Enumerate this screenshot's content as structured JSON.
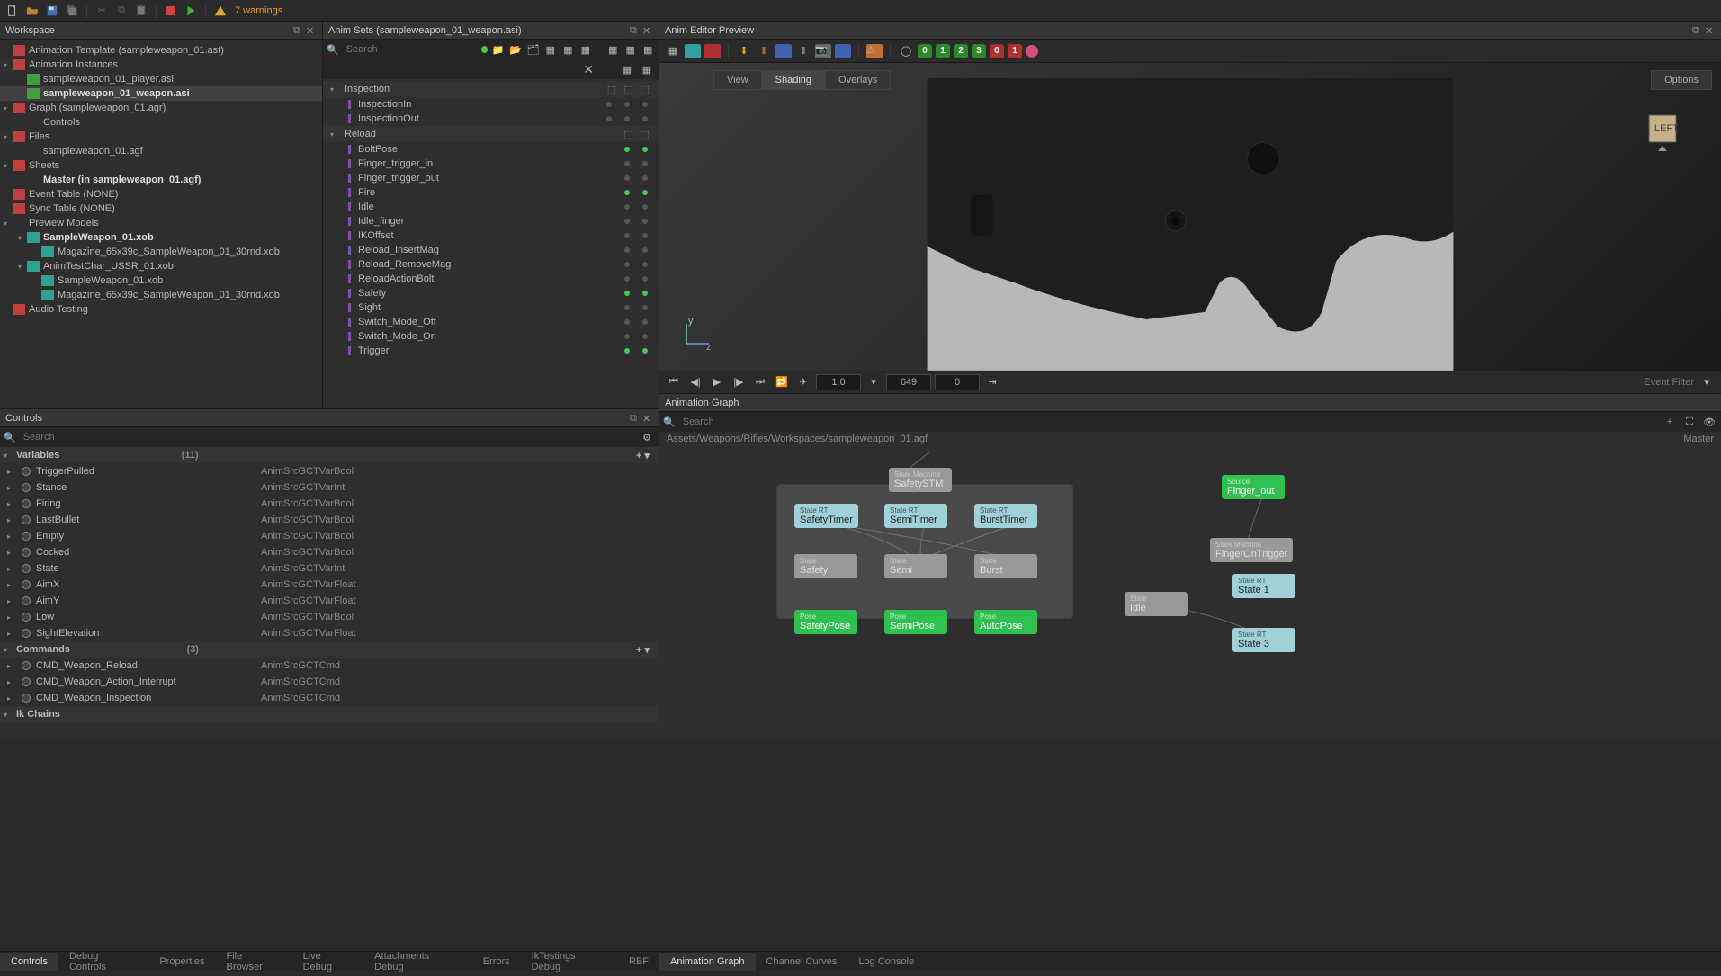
{
  "toolbar": {
    "warnings_text": "7 warnings"
  },
  "workspace": {
    "title": "Workspace",
    "tree": [
      {
        "label": "Animation Template (sampleweapon_01.ast)",
        "icon": "red",
        "depth": 0,
        "arrow": ""
      },
      {
        "label": "Animation Instances",
        "icon": "red",
        "depth": 0,
        "arrow": "▾"
      },
      {
        "label": "sampleweapon_01_player.asi",
        "icon": "green",
        "depth": 1,
        "arrow": ""
      },
      {
        "label": "sampleweapon_01_weapon.asi",
        "icon": "green",
        "depth": 1,
        "arrow": "",
        "sel": true,
        "bold": true
      },
      {
        "label": "Graph (sampleweapon_01.agr)",
        "icon": "red",
        "depth": 0,
        "arrow": "▾"
      },
      {
        "label": "Controls",
        "icon": "",
        "depth": 1,
        "arrow": ""
      },
      {
        "label": "Files",
        "icon": "red",
        "depth": 0,
        "arrow": "▾"
      },
      {
        "label": "sampleweapon_01.agf",
        "icon": "",
        "depth": 1,
        "arrow": ""
      },
      {
        "label": "Sheets",
        "icon": "red",
        "depth": 0,
        "arrow": "▾"
      },
      {
        "label": "Master (in sampleweapon_01.agf)",
        "icon": "",
        "depth": 1,
        "arrow": "",
        "bold": true
      },
      {
        "label": "Event Table (NONE)",
        "icon": "red",
        "depth": 0,
        "arrow": ""
      },
      {
        "label": "Sync Table (NONE)",
        "icon": "red",
        "depth": 0,
        "arrow": ""
      },
      {
        "label": "Preview Models",
        "icon": "",
        "depth": 0,
        "arrow": "▾"
      },
      {
        "label": "SampleWeapon_01.xob",
        "icon": "teal",
        "depth": 1,
        "arrow": "▾",
        "bold": true
      },
      {
        "label": "Magazine_65x39c_SampleWeapon_01_30rnd.xob",
        "icon": "teal",
        "depth": 2,
        "arrow": ""
      },
      {
        "label": "AnimTestChar_USSR_01.xob",
        "icon": "teal",
        "depth": 1,
        "arrow": "▾"
      },
      {
        "label": "SampleWeapon_01.xob",
        "icon": "teal",
        "depth": 2,
        "arrow": ""
      },
      {
        "label": "Magazine_65x39c_SampleWeapon_01_30rnd.xob",
        "icon": "teal",
        "depth": 2,
        "arrow": ""
      },
      {
        "label": "Audio Testing",
        "icon": "red",
        "depth": 0,
        "arrow": ""
      }
    ]
  },
  "animsets": {
    "title": "Anim Sets (sampleweapon_01_weapon.asi)",
    "search_placeholder": "Search",
    "groups": [
      {
        "name": "Inspection",
        "items": [
          {
            "name": "InspectionIn",
            "d1": false,
            "d2": false,
            "d3": false
          },
          {
            "name": "InspectionOut",
            "d1": false,
            "d2": false,
            "d3": false
          }
        ]
      },
      {
        "name": "Reload",
        "items": [
          {
            "name": "BoltPose",
            "d1": true,
            "d2": true
          },
          {
            "name": "Finger_trigger_in",
            "d1": false,
            "d2": false
          },
          {
            "name": "Finger_trigger_out",
            "d1": false,
            "d2": false
          },
          {
            "name": "Fire",
            "d1": true,
            "d2": true
          },
          {
            "name": "Idle",
            "d1": false,
            "d2": false
          },
          {
            "name": "Idle_finger",
            "d1": false,
            "d2": false
          },
          {
            "name": "IKOffset",
            "d1": false,
            "d2": false
          },
          {
            "name": "Reload_InsertMag",
            "d1": false,
            "d2": false
          },
          {
            "name": "Reload_RemoveMag",
            "d1": false,
            "d2": false
          },
          {
            "name": "ReloadActionBolt",
            "d1": false,
            "d2": false
          },
          {
            "name": "Safety",
            "d1": true,
            "d2": true
          },
          {
            "name": "Sight",
            "d1": false,
            "d2": false
          },
          {
            "name": "Switch_Mode_Off",
            "d1": false,
            "d2": false
          },
          {
            "name": "Switch_Mode_On",
            "d1": false,
            "d2": false
          },
          {
            "name": "Trigger",
            "d1": true,
            "d2": true
          }
        ]
      }
    ]
  },
  "preview": {
    "title": "Anim Editor Preview",
    "tabs": {
      "view": "View",
      "shading": "Shading",
      "overlays": "Overlays"
    },
    "options_label": "Options",
    "badges": [
      "0",
      "1",
      "2",
      "3",
      "0",
      "1"
    ],
    "cube_label": "LEFT"
  },
  "controls": {
    "title": "Controls",
    "search_placeholder": "Search",
    "variables_label": "Variables",
    "variables_count": "(11)",
    "commands_label": "Commands",
    "commands_count": "(3)",
    "ik_label": "Ik Chains",
    "vars": [
      {
        "name": "TriggerPulled",
        "type": "AnimSrcGCTVarBool"
      },
      {
        "name": "Stance",
        "type": "AnimSrcGCTVarInt"
      },
      {
        "name": "Firing",
        "type": "AnimSrcGCTVarBool"
      },
      {
        "name": "LastBullet",
        "type": "AnimSrcGCTVarBool"
      },
      {
        "name": "Empty",
        "type": "AnimSrcGCTVarBool"
      },
      {
        "name": "Cocked",
        "type": "AnimSrcGCTVarBool"
      },
      {
        "name": "State",
        "type": "AnimSrcGCTVarInt"
      },
      {
        "name": "AimX",
        "type": "AnimSrcGCTVarFloat"
      },
      {
        "name": "AimY",
        "type": "AnimSrcGCTVarFloat"
      },
      {
        "name": "Low",
        "type": "AnimSrcGCTVarBool"
      },
      {
        "name": "SightElevation",
        "type": "AnimSrcGCTVarFloat"
      }
    ],
    "cmds": [
      {
        "name": "CMD_Weapon_Reload",
        "type": "AnimSrcGCTCmd"
      },
      {
        "name": "CMD_Weapon_Action_Interrupt",
        "type": "AnimSrcGCTCmd"
      },
      {
        "name": "CMD_Weapon_Inspection",
        "type": "AnimSrcGCTCmd"
      }
    ]
  },
  "playback": {
    "speed": "1.0",
    "total": "649",
    "current": "0",
    "event_filter": "Event Filter"
  },
  "graph": {
    "title": "Animation Graph",
    "search_placeholder": "Search",
    "path": "Assets/Weapons/Rifles/Workspaces/sampleweapon_01.agf",
    "sheet": "Master",
    "nodes": {
      "sm_safety": {
        "hdr": "State Machine",
        "name": "SafetySTM"
      },
      "rt_safety": {
        "hdr": "State RT",
        "name": "SafetyTimer"
      },
      "rt_semi": {
        "hdr": "State RT",
        "name": "SemiTimer"
      },
      "rt_burst": {
        "hdr": "State RT",
        "name": "BurstTimer"
      },
      "st_safety": {
        "hdr": "State",
        "name": "Safety"
      },
      "st_semi": {
        "hdr": "State",
        "name": "Semi"
      },
      "st_burst": {
        "hdr": "State",
        "name": "Burst"
      },
      "p_safety": {
        "hdr": "Pose",
        "name": "SafetyPose"
      },
      "p_semi": {
        "hdr": "Pose",
        "name": "SemiPose"
      },
      "p_auto": {
        "hdr": "Pose",
        "name": "AutoPose"
      },
      "src_finger": {
        "hdr": "Source",
        "name": "Finger_out"
      },
      "sm_finger": {
        "hdr": "State Machine",
        "name": "FingerOnTrigger"
      },
      "st_idle": {
        "hdr": "State",
        "name": "Idle"
      },
      "rt_s1": {
        "hdr": "State RT",
        "name": "State 1"
      },
      "rt_s3": {
        "hdr": "State RT",
        "name": "State 3"
      }
    }
  },
  "bottom_tabs_left": [
    "Controls",
    "Debug Controls",
    "Properties",
    "File Browser",
    "Live Debug",
    "Attachments Debug",
    "Errors",
    "IkTestings Debug",
    "RBF"
  ],
  "bottom_tabs_right": [
    "Animation Graph",
    "Channel Curves",
    "Log Console"
  ]
}
